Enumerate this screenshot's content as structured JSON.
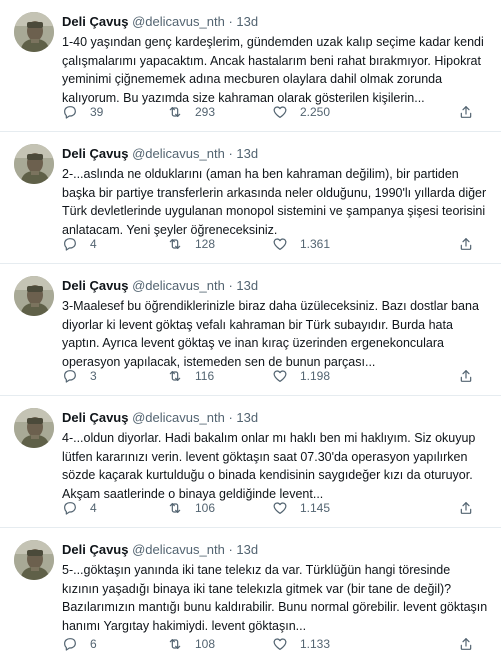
{
  "tweets": [
    {
      "name": "Deli Çavuş",
      "handle": "@delicavus_nth",
      "separator": "·",
      "time": "13d",
      "text": "1-40 yaşından genç kardeşlerim, gündemden uzak kalıp seçime kadar kendi çalışmalarımı yapacaktım. Ancak hastalarım beni rahat bırakmıyor. Hipokrat yeminimi çiğnememek adına mecburen olaylara dahil olmak zorunda kalıyorum. Bu yazımda size kahraman olarak gösterilen kişilerin...",
      "replies": "39",
      "retweets": "293",
      "likes": "2.250"
    },
    {
      "name": "Deli Çavuş",
      "handle": "@delicavus_nth",
      "separator": "·",
      "time": "13d",
      "text": "2-...aslında ne olduklarını (aman ha ben kahraman değilim), bir partiden başka bir partiye transferlerin arkasında neler olduğunu, 1990'lı yıllarda diğer Türk devletlerinde uygulanan monopol sistemini ve şampanya şişesi teorisini anlatacam. Yeni şeyler öğreneceksiniz.",
      "replies": "4",
      "retweets": "128",
      "likes": "1.361"
    },
    {
      "name": "Deli Çavuş",
      "handle": "@delicavus_nth",
      "separator": "·",
      "time": "13d",
      "text": "3-Maalesef bu öğrendiklerinizle biraz daha üzüleceksiniz. Bazı dostlar bana diyorlar ki levent göktaş vefalı kahraman bir Türk subayıdır. Burda hata yaptın. Ayrıca levent göktaş ve inan kıraç üzerinden ergenekonculara operasyon yapılacak, istemeden sen de bunun parçası...",
      "replies": "3",
      "retweets": "116",
      "likes": "1.198"
    },
    {
      "name": "Deli Çavuş",
      "handle": "@delicavus_nth",
      "separator": "·",
      "time": "13d",
      "text": "4-...oldun diyorlar. Hadi bakalım onlar mı haklı ben mi haklıyım. Siz okuyup lütfen kararınızı verin. levent göktaşın saat 07.30'da operasyon yapılırken sözde kaçarak kurtulduğu o binada kendisinin saygıdeğer kızı da oturuyor. Akşam saatlerinde o binaya geldiğinde levent...",
      "replies": "4",
      "retweets": "106",
      "likes": "1.145"
    },
    {
      "name": "Deli Çavuş",
      "handle": "@delicavus_nth",
      "separator": "·",
      "time": "13d",
      "text": "5-...göktaşın yanında iki tane telekız da var. Türklüğün hangi töresinde kızının yaşadığı binaya iki tane telekızla gitmek var (bir tane de değil)? Bazılarımızın mantığı bunu kaldırabilir. Bunu normal görebilir. levent göktaşın hanımı Yargıtay hakimiydi. levent göktaşın...",
      "replies": "6",
      "retweets": "108",
      "likes": "1.133"
    }
  ],
  "icons": {
    "reply": "reply-icon",
    "retweet": "retweet-icon",
    "like": "heart-icon",
    "share": "share-icon"
  },
  "colors": {
    "text": "#0f1419",
    "secondary": "#536471",
    "divider": "#e6ecf0"
  }
}
